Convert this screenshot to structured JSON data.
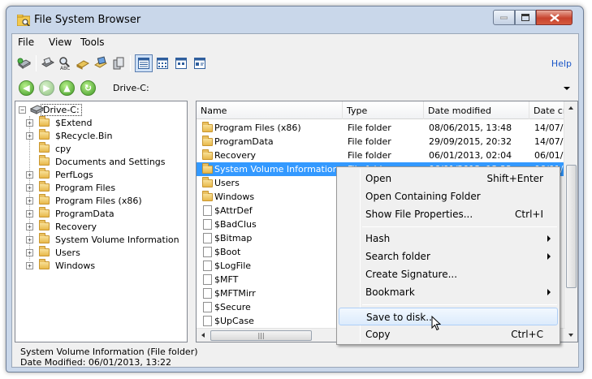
{
  "window": {
    "title": "File System Browser"
  },
  "menubar": {
    "items": [
      "File",
      "View",
      "Tools"
    ]
  },
  "toolbar": {
    "icons": [
      "open-drive-icon",
      "open-evidence-icon",
      "search-text-icon",
      "hash-icon",
      "image-icon",
      "copy-icon"
    ],
    "view_icons": [
      "details-view-icon",
      "list-view-icon",
      "small-icons-view-icon",
      "tiles-view-icon"
    ],
    "help_label": "Help"
  },
  "address": {
    "value": "Drive-C:"
  },
  "tree": {
    "root": "Drive-C:",
    "items": [
      {
        "label": "$Extend",
        "expandable": true
      },
      {
        "label": "$Recycle.Bin",
        "expandable": true
      },
      {
        "label": "cpy",
        "expandable": false
      },
      {
        "label": "Documents and Settings",
        "expandable": false
      },
      {
        "label": "PerfLogs",
        "expandable": true
      },
      {
        "label": "Program Files",
        "expandable": true
      },
      {
        "label": "Program Files (x86)",
        "expandable": true
      },
      {
        "label": "ProgramData",
        "expandable": true
      },
      {
        "label": "Recovery",
        "expandable": true
      },
      {
        "label": "System Volume Information",
        "expandable": true
      },
      {
        "label": "Users",
        "expandable": true
      },
      {
        "label": "Windows",
        "expandable": true
      }
    ]
  },
  "list": {
    "columns": [
      "Name",
      "Type",
      "Date modified",
      "Date cr"
    ],
    "rows": [
      {
        "name": "Program Files (x86)",
        "type": "File folder",
        "modified": "08/06/2015, 13:48",
        "created": "14/07/",
        "icon": "folder",
        "selected": false
      },
      {
        "name": "ProgramData",
        "type": "File folder",
        "modified": "29/09/2015, 20:32",
        "created": "14/07/",
        "icon": "folder",
        "selected": false
      },
      {
        "name": "Recovery",
        "type": "File folder",
        "modified": "06/01/2013, 02:04",
        "created": "06/01/",
        "icon": "folder",
        "selected": false
      },
      {
        "name": "System Volume Information",
        "type": "File folder",
        "modified": "06/01/2013, 13:22",
        "created": "06/01/",
        "icon": "folder",
        "selected": true
      },
      {
        "name": "Users",
        "type": "",
        "modified": "",
        "created": "",
        "icon": "folder",
        "selected": false
      },
      {
        "name": "Windows",
        "type": "",
        "modified": "",
        "created": "",
        "icon": "folder",
        "selected": false
      },
      {
        "name": "$AttrDef",
        "type": "",
        "modified": "",
        "created": "",
        "icon": "file",
        "selected": false
      },
      {
        "name": "$BadClus",
        "type": "",
        "modified": "",
        "created": "",
        "icon": "file",
        "selected": false
      },
      {
        "name": "$Bitmap",
        "type": "",
        "modified": "",
        "created": "",
        "icon": "file",
        "selected": false
      },
      {
        "name": "$Boot",
        "type": "",
        "modified": "",
        "created": "",
        "icon": "file",
        "selected": false
      },
      {
        "name": "$LogFile",
        "type": "",
        "modified": "",
        "created": "",
        "icon": "file",
        "selected": false
      },
      {
        "name": "$MFT",
        "type": "",
        "modified": "",
        "created": "",
        "icon": "file",
        "selected": false
      },
      {
        "name": "$MFTMirr",
        "type": "",
        "modified": "",
        "created": "",
        "icon": "file",
        "selected": false
      },
      {
        "name": "$Secure",
        "type": "",
        "modified": "",
        "created": "",
        "icon": "file",
        "selected": false
      },
      {
        "name": "$UpCase",
        "type": "",
        "modified": "",
        "created": "",
        "icon": "file",
        "selected": false
      }
    ],
    "hscroll_grip": "|||"
  },
  "status": {
    "line1": "System Volume Information (File folder)",
    "line2": "Date Modified: 06/01/2013, 13:22"
  },
  "context_menu": {
    "open": {
      "label": "Open",
      "shortcut": "Shift+Enter"
    },
    "open_containing": {
      "label": "Open Containing Folder"
    },
    "show_props": {
      "label": "Show File Properties...",
      "shortcut": "Ctrl+I"
    },
    "hash": {
      "label": "Hash"
    },
    "search_folder": {
      "label": "Search folder"
    },
    "create_signature": {
      "label": "Create Signature..."
    },
    "bookmark": {
      "label": "Bookmark"
    },
    "save_to_disk": {
      "label": "Save to disk..."
    },
    "copy": {
      "label": "Copy",
      "shortcut": "Ctrl+C"
    }
  },
  "colors": {
    "selection": "#3399ff",
    "window_frame": "#c9d7ea",
    "help_link": "#1a56c8"
  }
}
